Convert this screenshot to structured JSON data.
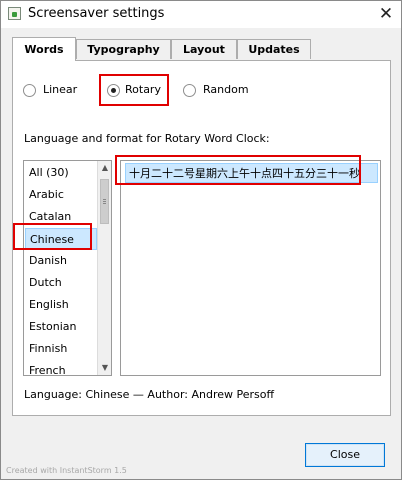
{
  "window": {
    "title": "Screensaver settings"
  },
  "icons": {
    "app": "screensaver-app-icon",
    "close": "close-icon"
  },
  "tabs": [
    {
      "label": "Words",
      "active": true
    },
    {
      "label": "Typography",
      "active": false
    },
    {
      "label": "Layout",
      "active": false
    },
    {
      "label": "Updates",
      "active": false
    }
  ],
  "mode_options": [
    {
      "label": "Linear",
      "checked": false
    },
    {
      "label": "Rotary",
      "checked": true
    },
    {
      "label": "Random",
      "checked": false
    }
  ],
  "language_section_label": "Language and format for Rotary Word Clock:",
  "languages": [
    "All (30)",
    "Arabic",
    "Catalan",
    "Chinese",
    "Danish",
    "Dutch",
    "English",
    "Estonian",
    "Finnish",
    "French"
  ],
  "selected_language": "Chinese",
  "format_options": [
    "十月二十二号星期六上午十点四十五分三十一秒"
  ],
  "info_line": "Language: Chinese — Author: Andrew Persoff",
  "close_button_label": "Close",
  "watermark": "Created with InstantStorm 1.5",
  "colors": {
    "highlight": "#e00000",
    "selection": "#cce8ff",
    "button_border": "#0078d7"
  }
}
